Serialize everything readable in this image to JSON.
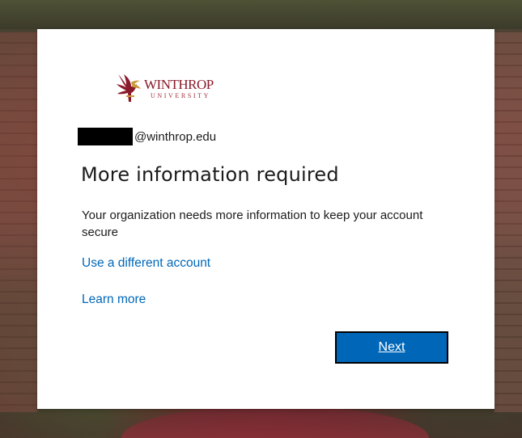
{
  "logo": {
    "wordmark": "WINTHROP",
    "subtitle": "UNIVERSITY",
    "brand_color": "#8a1a2a"
  },
  "identity": {
    "email_suffix": "@winthrop.edu"
  },
  "title": "More information required",
  "description": "Your organization needs more information to keep your account secure",
  "links": {
    "use_different_account": "Use a different account",
    "learn_more": "Learn more"
  },
  "buttons": {
    "next": "Next"
  },
  "colors": {
    "accent": "#0067b8",
    "text": "#1b1b1b"
  }
}
